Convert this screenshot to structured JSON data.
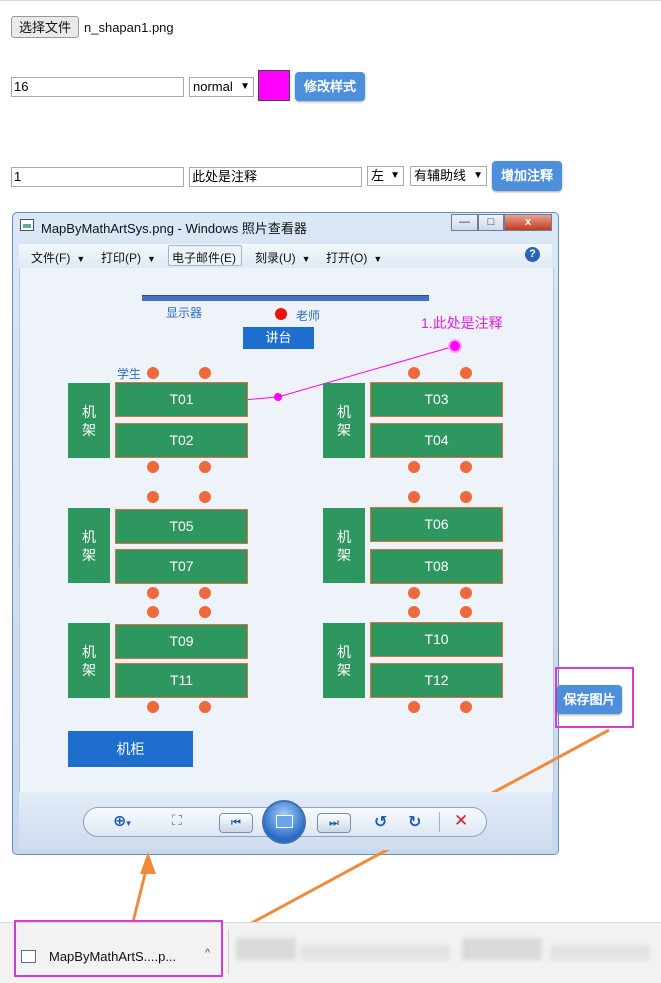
{
  "file_picker": {
    "button_label": "选择文件",
    "filename": "n_shapan1.png"
  },
  "style_form": {
    "font_size_value": "16",
    "font_weight_select": "normal",
    "swatch_color": "#ff00ff",
    "submit_label": "修改样式"
  },
  "annotation_form": {
    "number_value": "1",
    "text_value": "此处是注释",
    "position_select": "左",
    "guide_select": "有辅助线",
    "submit_label": "增加注释"
  },
  "viewer": {
    "title": "MapByMathArtSys.png - Windows 照片查看器",
    "window_buttons": [
      "—",
      "□",
      "x"
    ],
    "menu": [
      {
        "label": "文件(F)",
        "has_arrow": true
      },
      {
        "label": "打印(P)",
        "has_arrow": true
      },
      {
        "label": "电子邮件(E)",
        "has_arrow": false
      },
      {
        "label": "刻录(U)",
        "has_arrow": true
      },
      {
        "label": "打开(O)",
        "has_arrow": true
      }
    ],
    "help_label": "?",
    "toolbar_icons": [
      "zoom-icon",
      "fit-window-icon",
      "previous-icon",
      "slideshow-icon",
      "next-icon",
      "rotate-left-icon",
      "rotate-right-icon",
      "delete-icon"
    ]
  },
  "classroom_map": {
    "screen_label": "显示器",
    "teacher_label": "老师",
    "podium_label": "讲台",
    "student_label": "学生",
    "annotation_text": "1.此处是注释",
    "rack_label": "机架",
    "cabinet_label": "机柜",
    "desks": [
      "T01",
      "T02",
      "T03",
      "T04",
      "T05",
      "T07",
      "T06",
      "T08",
      "T09",
      "T11",
      "T10",
      "T12"
    ]
  },
  "save_button_label": "保存图片",
  "download_bar": {
    "filename": "MapByMathArtS....p..."
  },
  "colors": {
    "accent_blue": "#4e8fdb",
    "desk_green": "#2e9760",
    "seat_orange": "#ee6a3d",
    "highlight_magenta": "#d83cd8",
    "arrow_orange": "#f08a3c"
  }
}
